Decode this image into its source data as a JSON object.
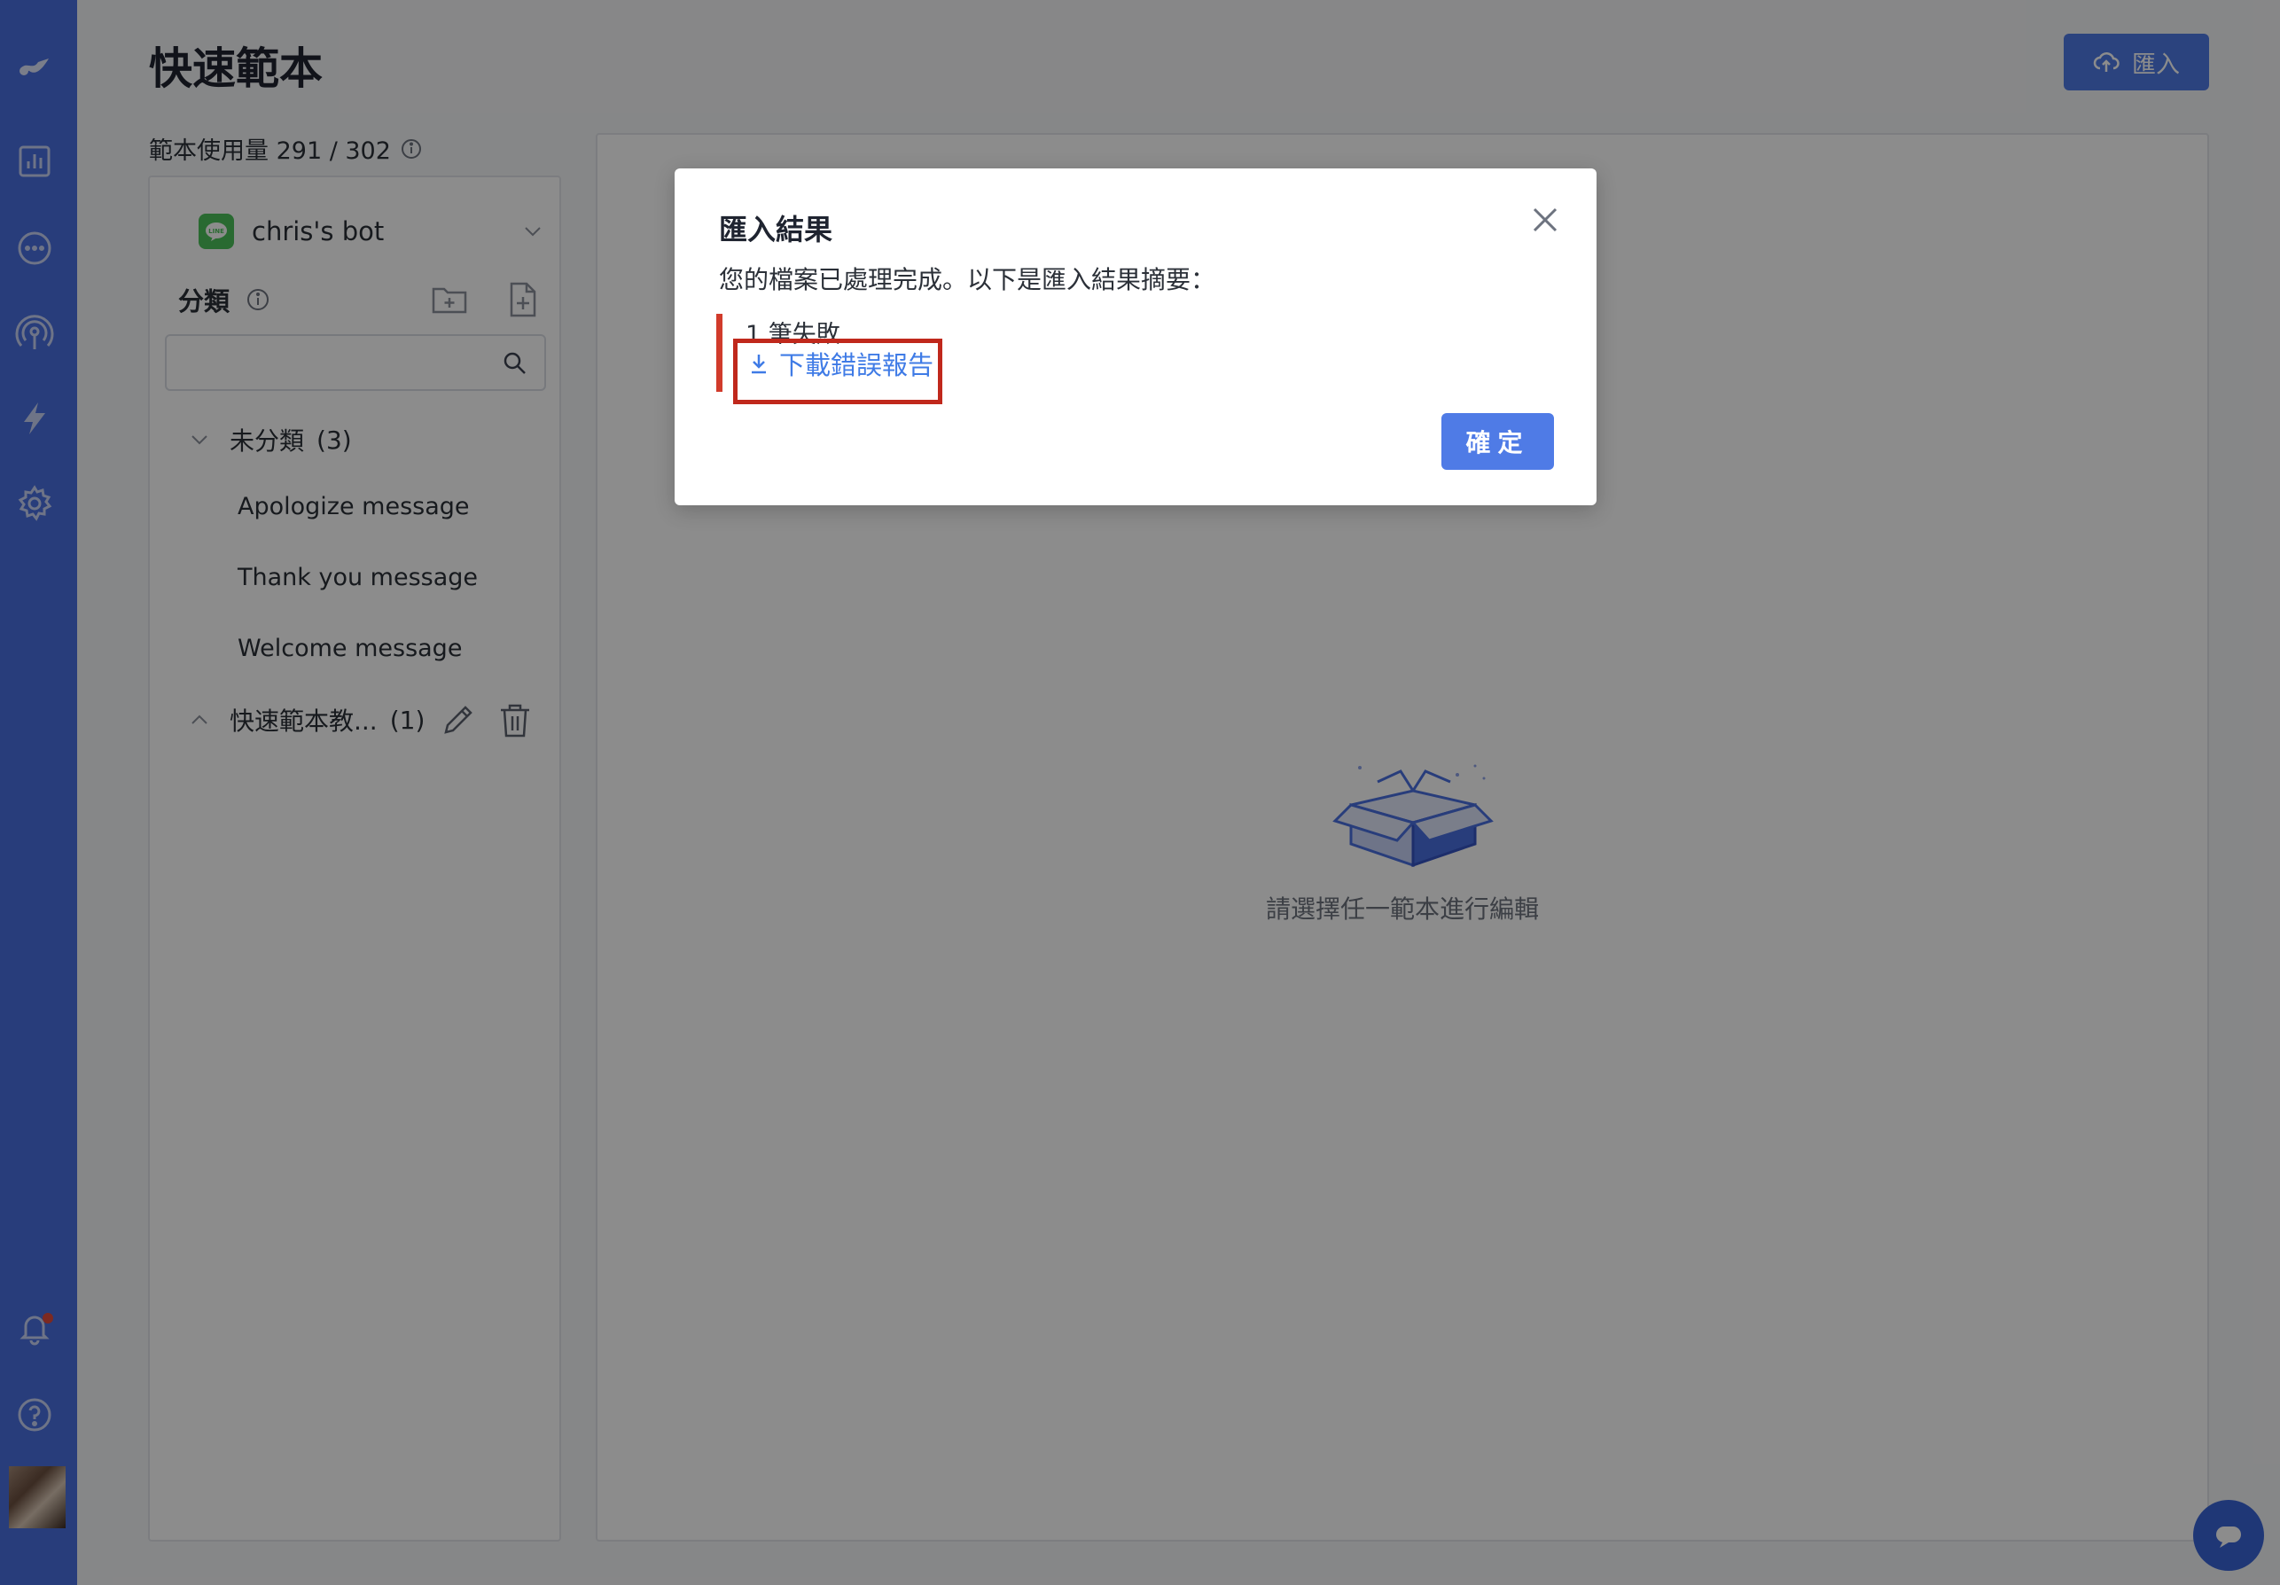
{
  "app": {
    "nav_icons": [
      "logo-icon",
      "analytics-icon",
      "chat-icon",
      "broadcast-icon",
      "automation-icon",
      "settings-icon",
      "notification-icon",
      "help-icon"
    ]
  },
  "header": {
    "title": "快速範本",
    "import_label": "匯入"
  },
  "usage": {
    "text": "範本使用量 291 / 302"
  },
  "sidebar": {
    "bot_name": "chris's bot",
    "category_title": "分類",
    "search_placeholder": "",
    "groups": [
      {
        "label": "未分類",
        "count": "(3)",
        "expanded": true,
        "items": [
          "Apologize message",
          "Thank you message",
          "Welcome message"
        ]
      },
      {
        "label": "快速範本教...",
        "count": "(1)",
        "expanded": false
      }
    ]
  },
  "main": {
    "empty_text": "請選擇任一範本進行編輯"
  },
  "modal": {
    "title": "匯入結果",
    "description": "您的檔案已處理完成。以下是匯入結果摘要：",
    "fail_summary": "1 筆失敗",
    "download_label": "下載錯誤報告",
    "ok_label": "確定"
  },
  "colors": {
    "accent": "#4f7be6",
    "rail": "#4a6fe0",
    "error": "#d13b2b",
    "line_green": "#4cc15a"
  }
}
